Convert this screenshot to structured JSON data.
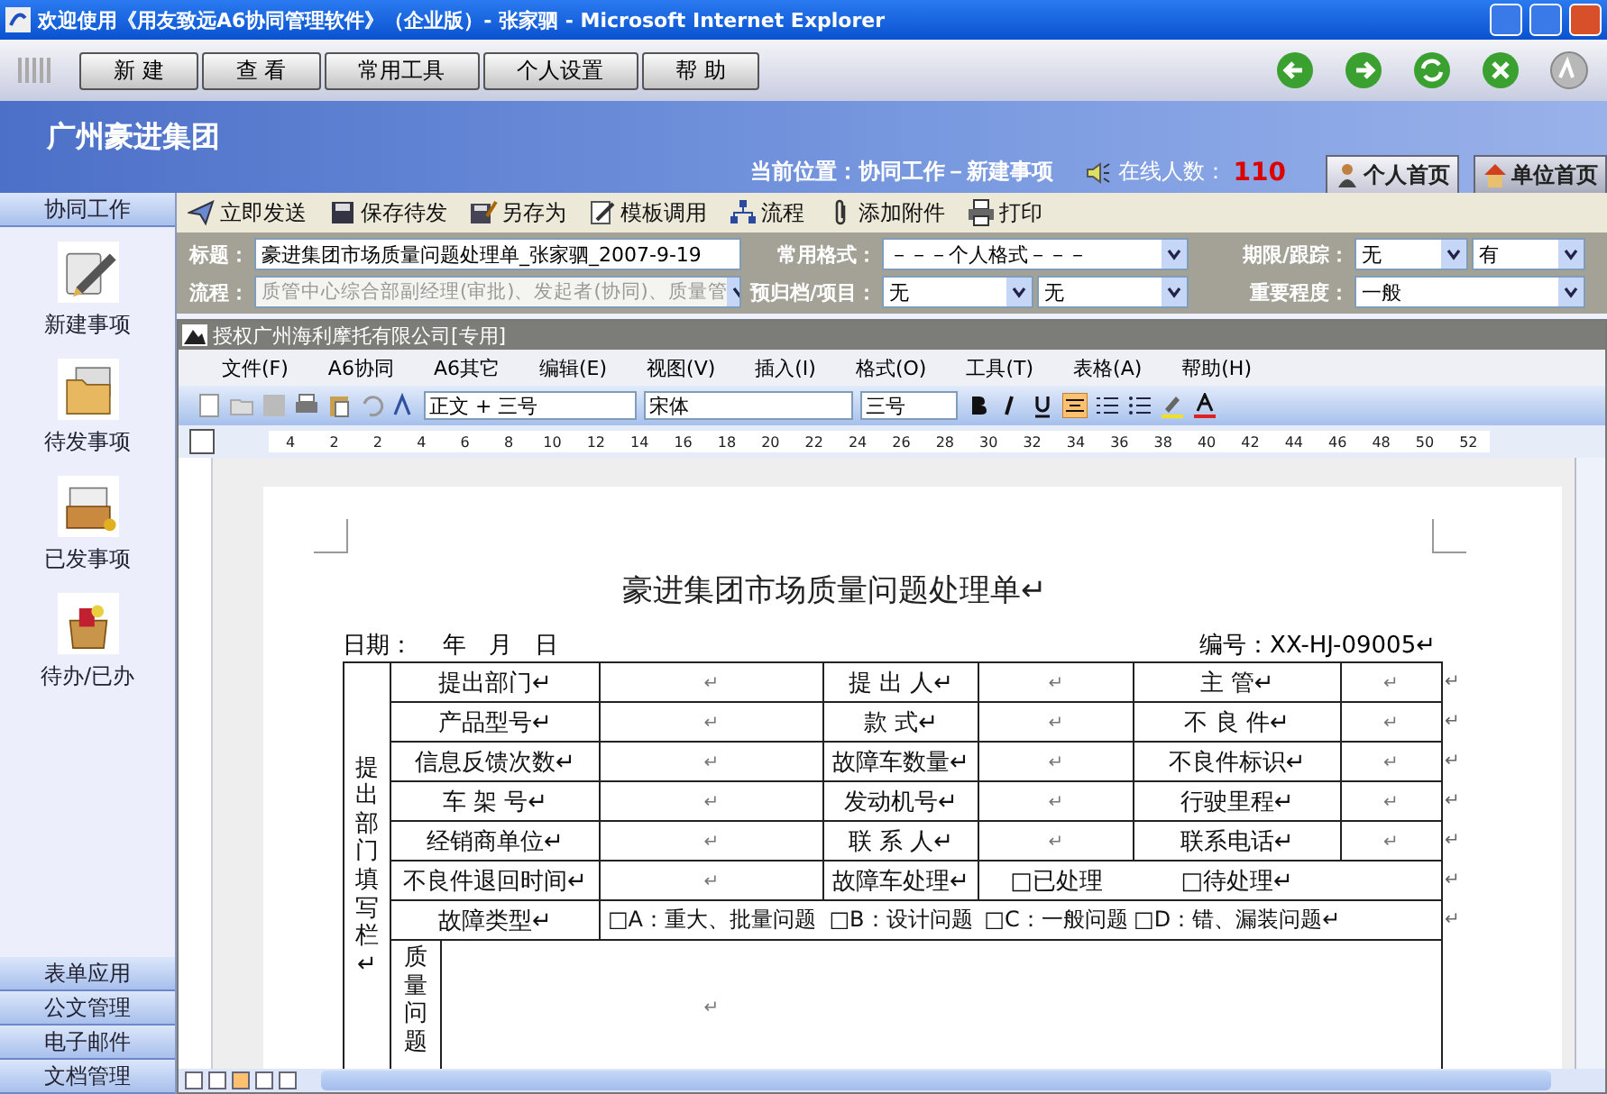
{
  "window": {
    "title": "欢迎使用《用友致远A6协同管理软件》（企业版）- 张家驷 - Microsoft Internet Explorer"
  },
  "top_menu": [
    {
      "label": "新 建"
    },
    {
      "label": "查 看"
    },
    {
      "label": "常用工具"
    },
    {
      "label": "个人设置"
    },
    {
      "label": "帮 助"
    }
  ],
  "header": {
    "company": "广州豪进集团",
    "location": "当前位置：协同工作－新建事项",
    "online_label": "在线人数：",
    "online_count": "110",
    "home_tabs": [
      {
        "label": "个人首页",
        "selected": true,
        "kind": "person"
      },
      {
        "label": "单位首页",
        "selected": false,
        "kind": "house"
      }
    ]
  },
  "sidebar": {
    "title": "协同工作",
    "items": [
      {
        "label": "新建事项",
        "kind": "compose"
      },
      {
        "label": "待发事项",
        "kind": "folder"
      },
      {
        "label": "已发事项",
        "kind": "cabinet"
      },
      {
        "label": "待办/已办",
        "kind": "box"
      }
    ],
    "sections": [
      "表单应用",
      "公文管理",
      "电子邮件",
      "文档管理"
    ]
  },
  "actions": [
    {
      "label": "立即发送",
      "kind": "send"
    },
    {
      "label": "保存待发",
      "kind": "save"
    },
    {
      "label": "另存为",
      "kind": "saveas"
    },
    {
      "label": "模板调用",
      "kind": "template"
    },
    {
      "label": "流程",
      "kind": "flow"
    },
    {
      "label": "添加附件",
      "kind": "attach"
    },
    {
      "label": "打印",
      "kind": "print"
    }
  ],
  "form": {
    "subject_label": "标题：",
    "subject": "豪进集团市场质量问题处理单_张家驷_2007-9-19",
    "flow_label": "流程：",
    "flow": "质管中心综合部副经理(审批)、发起者(协同)、质量管",
    "flow_disabled": true,
    "format_label": "常用格式：",
    "format": "－－－个人格式－－－",
    "deadline_label": "期限/跟踪：",
    "deadline": "无",
    "track": "有",
    "archive_label": "预归档/项目：",
    "archive": "无",
    "project": "无",
    "importance_label": "重要程度：",
    "importance": "一般"
  },
  "editor": {
    "title": "授权广州海利摩托有限公司[专用]",
    "menu": [
      "文件(F)",
      "A6协同",
      "A6其它",
      "编辑(E)",
      "视图(V)",
      "插入(I)",
      "格式(O)",
      "工具(T)",
      "表格(A)",
      "帮助(H)"
    ],
    "style": "正文 + 三号",
    "font": "宋体",
    "size": "三号",
    "ruler": [
      "4",
      "2",
      "2",
      "4",
      "6",
      "8",
      "10",
      "12",
      "14",
      "16",
      "18",
      "20",
      "22",
      "24",
      "26",
      "28",
      "30",
      "32",
      "34",
      "36",
      "38",
      "40",
      "42",
      "44",
      "46",
      "48",
      "50",
      "52"
    ]
  },
  "document": {
    "title": "豪进集团市场质量问题处理单↵",
    "date": "日期：    年   月   日",
    "number": "编号：XX-HJ-09005↵",
    "side_label": "提出部门填写栏↵",
    "rows": [
      {
        "kind": "grid",
        "cells": [
          "提出部门↵",
          "↵",
          "提 出 人↵",
          "↵",
          "主  管↵",
          "↵"
        ],
        "end": "↵"
      },
      {
        "kind": "grid",
        "cells": [
          "产品型号↵",
          "↵",
          "款  式↵",
          "↵",
          "不 良 件↵",
          "↵"
        ],
        "end": "↵"
      },
      {
        "kind": "grid",
        "cells": [
          "信息反馈次数↵",
          "↵",
          "故障车数量↵",
          "↵",
          "不良件标识↵",
          "↵"
        ],
        "end": "↵"
      },
      {
        "kind": "grid",
        "cells": [
          "车 架 号↵",
          "↵",
          "发动机号↵",
          "↵",
          "行驶里程↵",
          "↵"
        ],
        "end": "↵"
      },
      {
        "kind": "grid",
        "cells": [
          "经销商单位↵",
          "↵",
          "联 系 人↵",
          "↵",
          "联系电话↵",
          "↵"
        ],
        "end": "↵"
      },
      {
        "kind": "status",
        "cells": [
          "不良件退回时间↵",
          "↵",
          "故障车处理↵",
          "□已处理",
          "□待处理↵"
        ],
        "end": "↵"
      },
      {
        "kind": "wide",
        "cells": [
          "故障类型↵",
          "□A：重大、批量问题",
          "□B：设计问题",
          "□C：一般问题",
          "□D：错、漏装问题↵"
        ],
        "end": "↵"
      },
      {
        "kind": "note",
        "cells": [
          "质量问题",
          "↵"
        ]
      }
    ]
  }
}
